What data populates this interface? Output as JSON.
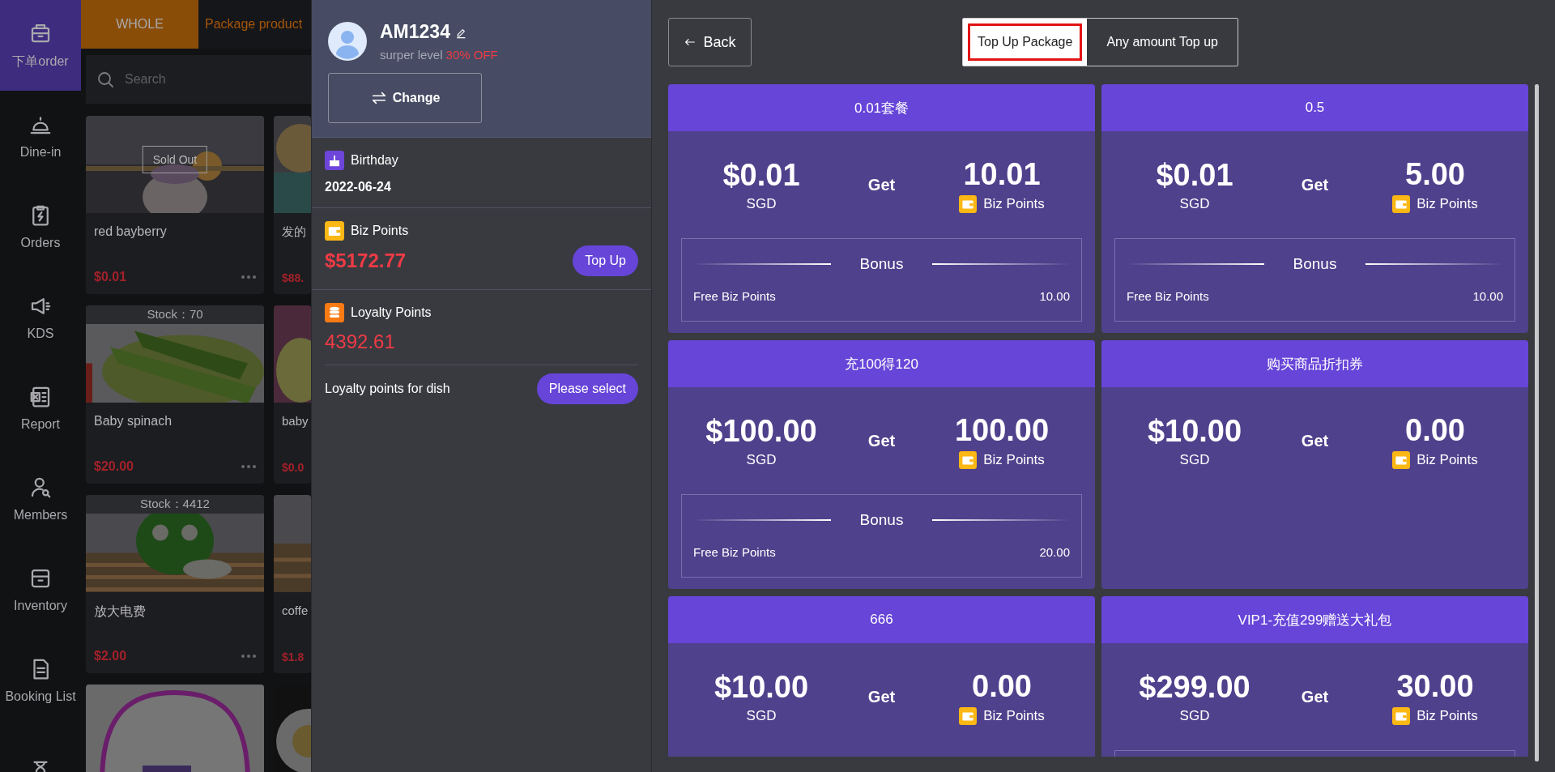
{
  "sidebar": {
    "items": [
      {
        "label": "下单order",
        "selected": true
      },
      {
        "label": "Dine-in",
        "selected": false
      },
      {
        "label": "Orders",
        "selected": false
      },
      {
        "label": "KDS",
        "selected": false
      },
      {
        "label": "Report",
        "selected": false
      },
      {
        "label": "Members",
        "selected": false
      },
      {
        "label": "Inventory",
        "selected": false
      },
      {
        "label": "Booking List",
        "selected": false
      },
      {
        "selected": false
      }
    ]
  },
  "products": {
    "tabs": [
      {
        "label": "WHOLE",
        "selected": true
      },
      {
        "label": "Package product",
        "selected": false
      }
    ],
    "search": {
      "placeholder": "Search"
    },
    "rows": [
      {
        "cards": [
          {
            "name": "red bayberry",
            "price": "$0.01",
            "sold_out": "Sold Out"
          },
          {
            "name": "发的",
            "price": "$88."
          }
        ]
      },
      {
        "cards": [
          {
            "name": "Baby spinach",
            "price": "$20.00",
            "stock": "Stock：70"
          },
          {
            "name": "baby",
            "price": "$0.0"
          }
        ]
      },
      {
        "cards": [
          {
            "name": "放大电费",
            "price": "$2.00",
            "stock": "Stock：4412"
          },
          {
            "name": "coffe",
            "price": "$1.8"
          }
        ]
      }
    ]
  },
  "member": {
    "name": "AM1234",
    "level": "surper level",
    "discount": "30% OFF",
    "change_button": "Change",
    "birthday": {
      "label": "Birthday",
      "value": "2022-06-24"
    },
    "biz_points": {
      "label": "Biz Points",
      "value": "$5172.77",
      "button": "Top Up"
    },
    "loyalty_points": {
      "label": "Loyalty Points",
      "value": "4392.61"
    },
    "dish_points": {
      "label": "Loyalty points for dish",
      "button": "Please select"
    }
  },
  "topup": {
    "back": "Back",
    "tabs": [
      {
        "label": "Top Up Package",
        "selected": true
      },
      {
        "label": "Any amount Top up",
        "selected": false
      }
    ],
    "packages": [
      {
        "title": "0.01套餐",
        "price": "$0.01",
        "currency": "SGD",
        "get": "Get",
        "points": "10.01",
        "points_label": "Biz Points",
        "bonus": {
          "title": "Bonus",
          "label": "Free Biz Points",
          "value": "10.00"
        }
      },
      {
        "title": "0.5",
        "price": "$0.01",
        "currency": "SGD",
        "get": "Get",
        "points": "5.00",
        "points_label": "Biz Points",
        "bonus": {
          "title": "Bonus",
          "label": "Free Biz Points",
          "value": "10.00"
        }
      },
      {
        "title": "充100得120",
        "price": "$100.00",
        "currency": "SGD",
        "get": "Get",
        "points": "100.00",
        "points_label": "Biz Points",
        "bonus": {
          "title": "Bonus",
          "label": "Free Biz Points",
          "value": "20.00"
        }
      },
      {
        "title": "购买商品折扣券",
        "price": "$10.00",
        "currency": "SGD",
        "get": "Get",
        "points": "0.00",
        "points_label": "Biz Points"
      },
      {
        "title": "666",
        "price": "$10.00",
        "currency": "SGD",
        "get": "Get",
        "points": "0.00",
        "points_label": "Biz Points"
      },
      {
        "title": "VIP1-充值299赠送大礼包",
        "price": "$299.00",
        "currency": "SGD",
        "get": "Get",
        "points": "30.00",
        "points_label": "Biz Points",
        "bonus_frame": true
      }
    ]
  }
}
